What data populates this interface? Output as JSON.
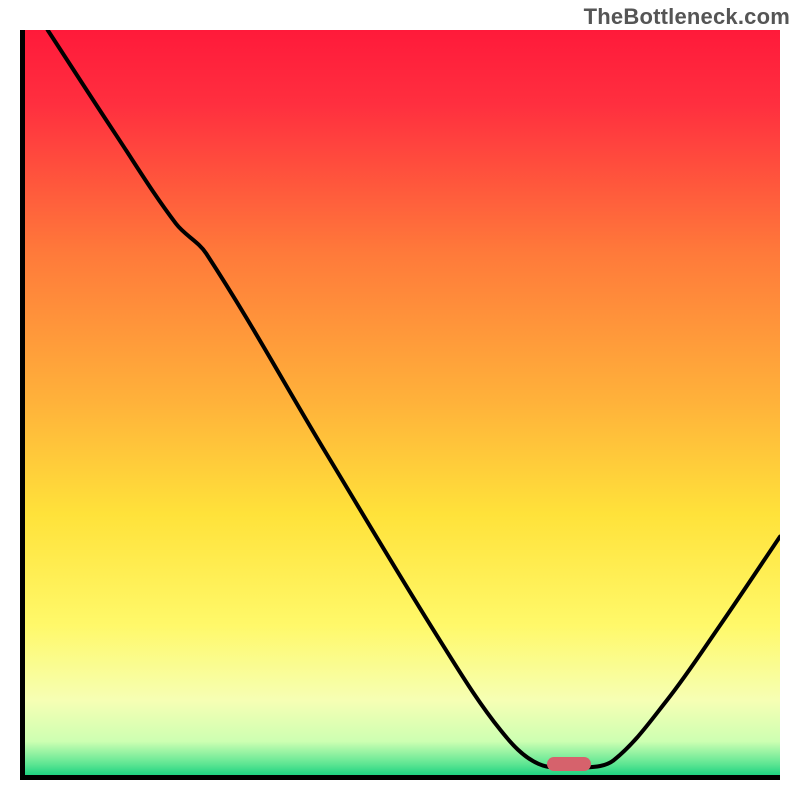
{
  "watermark": "TheBottleneck.com",
  "chart_data": {
    "type": "line",
    "title": "",
    "xlabel": "",
    "ylabel": "",
    "xlim": [
      0,
      100
    ],
    "ylim": [
      0,
      100
    ],
    "gradient_stops": [
      {
        "offset": 0,
        "color": "#ff1a3a"
      },
      {
        "offset": 0.1,
        "color": "#ff2f3f"
      },
      {
        "offset": 0.3,
        "color": "#ff7a3a"
      },
      {
        "offset": 0.5,
        "color": "#ffb23a"
      },
      {
        "offset": 0.65,
        "color": "#ffe23a"
      },
      {
        "offset": 0.8,
        "color": "#fff96a"
      },
      {
        "offset": 0.9,
        "color": "#f6ffb4"
      },
      {
        "offset": 0.955,
        "color": "#cdffb2"
      },
      {
        "offset": 0.985,
        "color": "#5fe693"
      },
      {
        "offset": 1.0,
        "color": "#1fd282"
      }
    ],
    "series": [
      {
        "name": "bottleneck-curve",
        "points": [
          {
            "x": 3,
            "y": 100
          },
          {
            "x": 12,
            "y": 86
          },
          {
            "x": 20,
            "y": 74
          },
          {
            "x": 24,
            "y": 70
          },
          {
            "x": 40,
            "y": 43
          },
          {
            "x": 55,
            "y": 18
          },
          {
            "x": 63,
            "y": 6
          },
          {
            "x": 68,
            "y": 1.5
          },
          {
            "x": 74,
            "y": 1
          },
          {
            "x": 78,
            "y": 2
          },
          {
            "x": 85,
            "y": 10
          },
          {
            "x": 92,
            "y": 20
          },
          {
            "x": 100,
            "y": 32
          }
        ]
      }
    ],
    "optimal_marker": {
      "x": 72,
      "y": 1.5
    }
  }
}
